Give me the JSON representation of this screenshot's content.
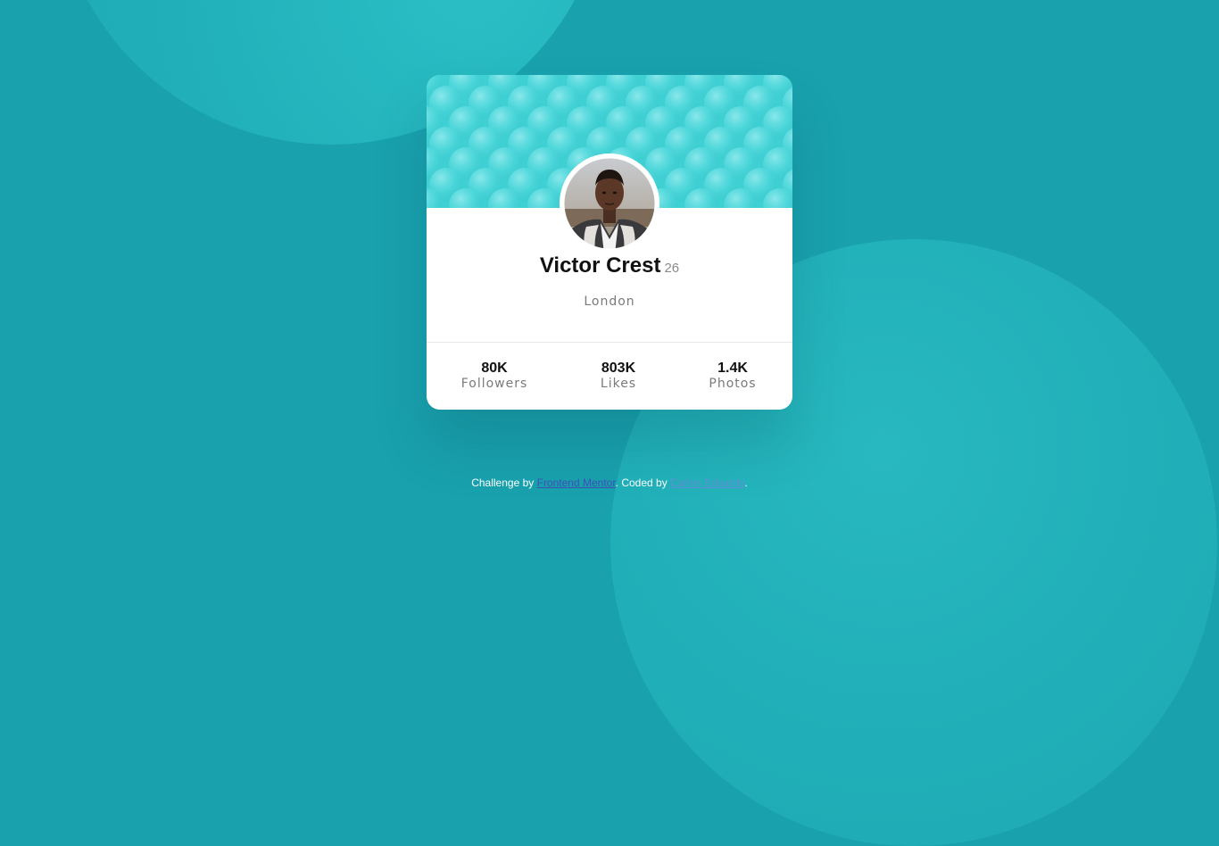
{
  "profile": {
    "name": "Victor Crest",
    "age": "26",
    "city": "London"
  },
  "stats": [
    {
      "value": "80K",
      "label": "Followers"
    },
    {
      "value": "803K",
      "label": "Likes"
    },
    {
      "value": "1.4K",
      "label": "Photos"
    }
  ],
  "footer": {
    "prefix": "Challenge by",
    "mentor_link": "Frontend Mentor",
    "middle": ". Coded by",
    "author_link": "Carlos Eduardo",
    "suffix": "."
  },
  "colors": {
    "background": "#19a1ae",
    "banner": "#3fd0d4",
    "card": "#ffffff"
  },
  "icons": {
    "avatar": "profile-photo"
  }
}
